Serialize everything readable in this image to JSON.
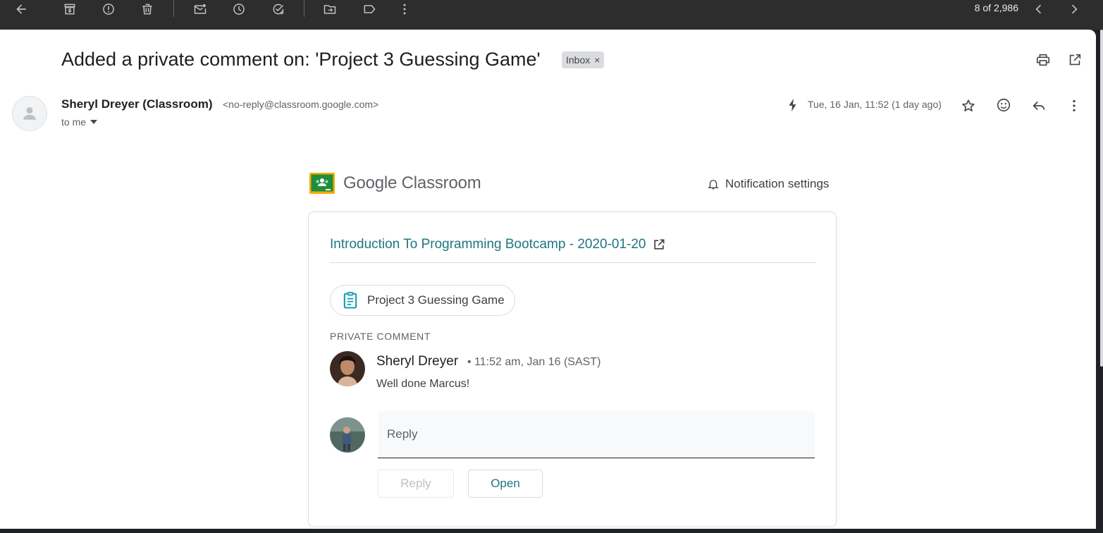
{
  "toolbar": {
    "counter": "8 of 2,986",
    "icons": [
      "back-arrow-icon",
      "archive-icon",
      "report-spam-icon",
      "delete-icon",
      "mark-unread-icon",
      "snooze-icon",
      "add-task-icon",
      "move-to-icon",
      "label-icon",
      "more-vert-icon",
      "chevron-left-icon",
      "chevron-right-icon"
    ]
  },
  "email": {
    "subject": "Added a private comment on: 'Project 3 Guessing Game'",
    "label": "Inbox",
    "label_close": "×",
    "sender_name": "Sheryl Dreyer (Classroom)",
    "sender_email": "<no-reply@classroom.google.com>",
    "recipient": "to me",
    "date": "Tue, 16 Jan, 11:52 (1 day ago)"
  },
  "body": {
    "brand_google": "Google",
    "brand_product": "Classroom",
    "notification_settings": "Notification settings",
    "course": "Introduction To Programming Bootcamp - 2020-01-20",
    "assignment": "Project 3 Guessing Game",
    "section_label": "PRIVATE COMMENT",
    "comment": {
      "author": "Sheryl Dreyer",
      "meta": "• 11:52 am, Jan 16 (SAST)",
      "text": "Well done Marcus!"
    },
    "reply_placeholder": "Reply",
    "reply_button": "Reply",
    "open_button": "Open"
  },
  "colors": {
    "toolbar_bg": "#2d2d2d",
    "accent_teal": "#1e7680",
    "classroom_green": "#1e8e3e",
    "classroom_yellow": "#f9ab00"
  }
}
